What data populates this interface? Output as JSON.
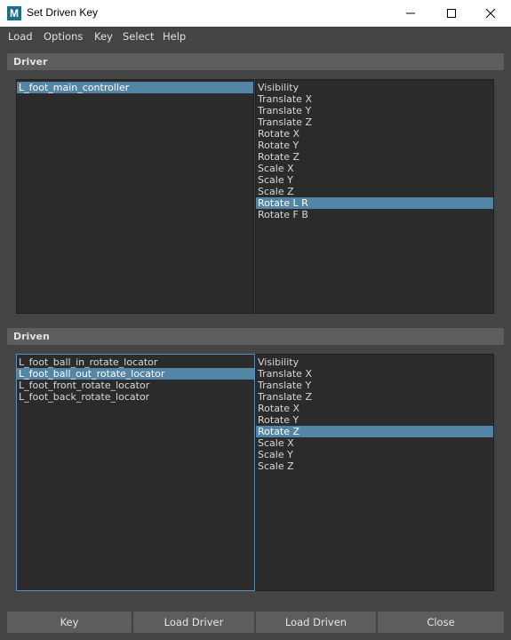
{
  "window": {
    "title": "Set Driven Key",
    "app_icon_letter": "M"
  },
  "menu": [
    "Load",
    "Options",
    "Key",
    "Select",
    "Help"
  ],
  "driver": {
    "header": "Driver",
    "objects": [
      {
        "label": "L_foot_main_controller",
        "selected": true
      }
    ],
    "attributes": [
      {
        "label": "Visibility",
        "selected": false
      },
      {
        "label": "Translate X",
        "selected": false
      },
      {
        "label": "Translate Y",
        "selected": false
      },
      {
        "label": "Translate Z",
        "selected": false
      },
      {
        "label": "Rotate X",
        "selected": false
      },
      {
        "label": "Rotate Y",
        "selected": false
      },
      {
        "label": "Rotate Z",
        "selected": false
      },
      {
        "label": "Scale X",
        "selected": false
      },
      {
        "label": "Scale Y",
        "selected": false
      },
      {
        "label": "Scale Z",
        "selected": false
      },
      {
        "label": "Rotate L R",
        "selected": true
      },
      {
        "label": "Rotate F B",
        "selected": false
      }
    ]
  },
  "driven": {
    "header": "Driven",
    "objects": [
      {
        "label": "L_foot_ball_in_rotate_locator",
        "selected": false
      },
      {
        "label": "L_foot_ball_out_rotate_locator",
        "selected": true
      },
      {
        "label": "L_foot_front_rotate_locator",
        "selected": false
      },
      {
        "label": "L_foot_back_rotate_locator",
        "selected": false
      }
    ],
    "attributes": [
      {
        "label": "Visibility",
        "selected": false
      },
      {
        "label": "Translate X",
        "selected": false
      },
      {
        "label": "Translate Y",
        "selected": false
      },
      {
        "label": "Translate Z",
        "selected": false
      },
      {
        "label": "Rotate X",
        "selected": false
      },
      {
        "label": "Rotate Y",
        "selected": false
      },
      {
        "label": "Rotate Z",
        "selected": true
      },
      {
        "label": "Scale X",
        "selected": false
      },
      {
        "label": "Scale Y",
        "selected": false
      },
      {
        "label": "Scale Z",
        "selected": false
      }
    ]
  },
  "buttons": {
    "key": "Key",
    "load_driver": "Load Driver",
    "load_driven": "Load Driven",
    "close": "Close"
  },
  "colors": {
    "selection": "#5285a6",
    "panel": "#444444",
    "list_bg": "#2b2b2b",
    "header_bg": "#5d5d5d",
    "focus_border": "#5b8fb5"
  }
}
